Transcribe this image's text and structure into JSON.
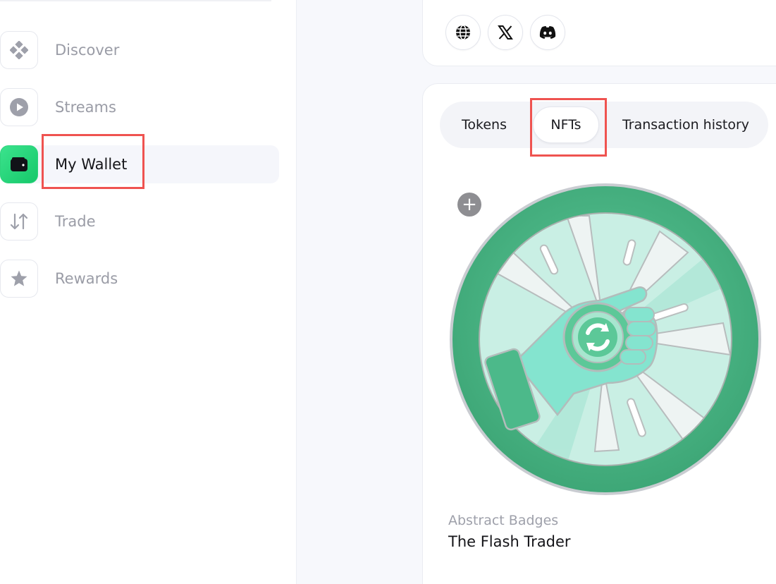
{
  "sidebar": {
    "items": [
      {
        "label": "Discover",
        "icon": "diamond-grid-icon",
        "active": false
      },
      {
        "label": "Streams",
        "icon": "play-circle-icon",
        "active": false
      },
      {
        "label": "My Wallet",
        "icon": "wallet-icon",
        "active": true
      },
      {
        "label": "Trade",
        "icon": "swap-arrows-icon",
        "active": false
      },
      {
        "label": "Rewards",
        "icon": "star-icon",
        "active": false
      }
    ]
  },
  "social": {
    "icons": [
      "globe-icon",
      "x-logo-icon",
      "discord-icon"
    ]
  },
  "tabs": [
    {
      "label": "Tokens",
      "active": false
    },
    {
      "label": "NFTs",
      "active": true
    },
    {
      "label": "Transaction history",
      "active": false
    }
  ],
  "nft": {
    "collection": "Abstract Badges",
    "name": "The Flash Trader",
    "add_symbol": "+"
  },
  "colors": {
    "accent": "#22d17a",
    "highlight": "#ef5350",
    "badge_green": "#4cb98a",
    "badge_mint": "#84e4cf"
  }
}
